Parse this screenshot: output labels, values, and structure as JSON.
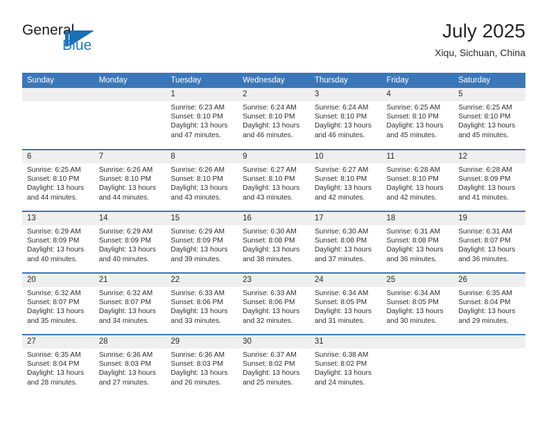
{
  "logo": {
    "word1": "General",
    "word2": "Blue",
    "mark": "flag-triangle-icon"
  },
  "header": {
    "title": "July 2025",
    "subtitle": "Xiqu, Sichuan, China"
  },
  "colors": {
    "header_blue": "#3b77b8",
    "logo_blue": "#1b6fb5",
    "daynum_band": "#efefef",
    "text": "#2d2d2d"
  },
  "weekday_headers": [
    "Sunday",
    "Monday",
    "Tuesday",
    "Wednesday",
    "Thursday",
    "Friday",
    "Saturday"
  ],
  "labels": {
    "sunrise_prefix": "Sunrise:",
    "sunset_prefix": "Sunset:",
    "daylight_prefix": "Daylight:"
  },
  "weeks": [
    [
      {
        "day": "",
        "sunrise": "",
        "sunset": "",
        "daylight_line1": "",
        "daylight_line2": ""
      },
      {
        "day": "",
        "sunrise": "",
        "sunset": "",
        "daylight_line1": "",
        "daylight_line2": ""
      },
      {
        "day": "1",
        "sunrise": "Sunrise: 6:23 AM",
        "sunset": "Sunset: 8:10 PM",
        "daylight_line1": "Daylight: 13 hours",
        "daylight_line2": "and 47 minutes."
      },
      {
        "day": "2",
        "sunrise": "Sunrise: 6:24 AM",
        "sunset": "Sunset: 8:10 PM",
        "daylight_line1": "Daylight: 13 hours",
        "daylight_line2": "and 46 minutes."
      },
      {
        "day": "3",
        "sunrise": "Sunrise: 6:24 AM",
        "sunset": "Sunset: 8:10 PM",
        "daylight_line1": "Daylight: 13 hours",
        "daylight_line2": "and 46 minutes."
      },
      {
        "day": "4",
        "sunrise": "Sunrise: 6:25 AM",
        "sunset": "Sunset: 8:10 PM",
        "daylight_line1": "Daylight: 13 hours",
        "daylight_line2": "and 45 minutes."
      },
      {
        "day": "5",
        "sunrise": "Sunrise: 6:25 AM",
        "sunset": "Sunset: 8:10 PM",
        "daylight_line1": "Daylight: 13 hours",
        "daylight_line2": "and 45 minutes."
      }
    ],
    [
      {
        "day": "6",
        "sunrise": "Sunrise: 6:25 AM",
        "sunset": "Sunset: 8:10 PM",
        "daylight_line1": "Daylight: 13 hours",
        "daylight_line2": "and 44 minutes."
      },
      {
        "day": "7",
        "sunrise": "Sunrise: 6:26 AM",
        "sunset": "Sunset: 8:10 PM",
        "daylight_line1": "Daylight: 13 hours",
        "daylight_line2": "and 44 minutes."
      },
      {
        "day": "8",
        "sunrise": "Sunrise: 6:26 AM",
        "sunset": "Sunset: 8:10 PM",
        "daylight_line1": "Daylight: 13 hours",
        "daylight_line2": "and 43 minutes."
      },
      {
        "day": "9",
        "sunrise": "Sunrise: 6:27 AM",
        "sunset": "Sunset: 8:10 PM",
        "daylight_line1": "Daylight: 13 hours",
        "daylight_line2": "and 43 minutes."
      },
      {
        "day": "10",
        "sunrise": "Sunrise: 6:27 AM",
        "sunset": "Sunset: 8:10 PM",
        "daylight_line1": "Daylight: 13 hours",
        "daylight_line2": "and 42 minutes."
      },
      {
        "day": "11",
        "sunrise": "Sunrise: 6:28 AM",
        "sunset": "Sunset: 8:10 PM",
        "daylight_line1": "Daylight: 13 hours",
        "daylight_line2": "and 42 minutes."
      },
      {
        "day": "12",
        "sunrise": "Sunrise: 6:28 AM",
        "sunset": "Sunset: 8:09 PM",
        "daylight_line1": "Daylight: 13 hours",
        "daylight_line2": "and 41 minutes."
      }
    ],
    [
      {
        "day": "13",
        "sunrise": "Sunrise: 6:29 AM",
        "sunset": "Sunset: 8:09 PM",
        "daylight_line1": "Daylight: 13 hours",
        "daylight_line2": "and 40 minutes."
      },
      {
        "day": "14",
        "sunrise": "Sunrise: 6:29 AM",
        "sunset": "Sunset: 8:09 PM",
        "daylight_line1": "Daylight: 13 hours",
        "daylight_line2": "and 40 minutes."
      },
      {
        "day": "15",
        "sunrise": "Sunrise: 6:29 AM",
        "sunset": "Sunset: 8:09 PM",
        "daylight_line1": "Daylight: 13 hours",
        "daylight_line2": "and 39 minutes."
      },
      {
        "day": "16",
        "sunrise": "Sunrise: 6:30 AM",
        "sunset": "Sunset: 8:08 PM",
        "daylight_line1": "Daylight: 13 hours",
        "daylight_line2": "and 38 minutes."
      },
      {
        "day": "17",
        "sunrise": "Sunrise: 6:30 AM",
        "sunset": "Sunset: 8:08 PM",
        "daylight_line1": "Daylight: 13 hours",
        "daylight_line2": "and 37 minutes."
      },
      {
        "day": "18",
        "sunrise": "Sunrise: 6:31 AM",
        "sunset": "Sunset: 8:08 PM",
        "daylight_line1": "Daylight: 13 hours",
        "daylight_line2": "and 36 minutes."
      },
      {
        "day": "19",
        "sunrise": "Sunrise: 6:31 AM",
        "sunset": "Sunset: 8:07 PM",
        "daylight_line1": "Daylight: 13 hours",
        "daylight_line2": "and 36 minutes."
      }
    ],
    [
      {
        "day": "20",
        "sunrise": "Sunrise: 6:32 AM",
        "sunset": "Sunset: 8:07 PM",
        "daylight_line1": "Daylight: 13 hours",
        "daylight_line2": "and 35 minutes."
      },
      {
        "day": "21",
        "sunrise": "Sunrise: 6:32 AM",
        "sunset": "Sunset: 8:07 PM",
        "daylight_line1": "Daylight: 13 hours",
        "daylight_line2": "and 34 minutes."
      },
      {
        "day": "22",
        "sunrise": "Sunrise: 6:33 AM",
        "sunset": "Sunset: 8:06 PM",
        "daylight_line1": "Daylight: 13 hours",
        "daylight_line2": "and 33 minutes."
      },
      {
        "day": "23",
        "sunrise": "Sunrise: 6:33 AM",
        "sunset": "Sunset: 8:06 PM",
        "daylight_line1": "Daylight: 13 hours",
        "daylight_line2": "and 32 minutes."
      },
      {
        "day": "24",
        "sunrise": "Sunrise: 6:34 AM",
        "sunset": "Sunset: 8:05 PM",
        "daylight_line1": "Daylight: 13 hours",
        "daylight_line2": "and 31 minutes."
      },
      {
        "day": "25",
        "sunrise": "Sunrise: 6:34 AM",
        "sunset": "Sunset: 8:05 PM",
        "daylight_line1": "Daylight: 13 hours",
        "daylight_line2": "and 30 minutes."
      },
      {
        "day": "26",
        "sunrise": "Sunrise: 6:35 AM",
        "sunset": "Sunset: 8:04 PM",
        "daylight_line1": "Daylight: 13 hours",
        "daylight_line2": "and 29 minutes."
      }
    ],
    [
      {
        "day": "27",
        "sunrise": "Sunrise: 6:35 AM",
        "sunset": "Sunset: 8:04 PM",
        "daylight_line1": "Daylight: 13 hours",
        "daylight_line2": "and 28 minutes."
      },
      {
        "day": "28",
        "sunrise": "Sunrise: 6:36 AM",
        "sunset": "Sunset: 8:03 PM",
        "daylight_line1": "Daylight: 13 hours",
        "daylight_line2": "and 27 minutes."
      },
      {
        "day": "29",
        "sunrise": "Sunrise: 6:36 AM",
        "sunset": "Sunset: 8:03 PM",
        "daylight_line1": "Daylight: 13 hours",
        "daylight_line2": "and 26 minutes."
      },
      {
        "day": "30",
        "sunrise": "Sunrise: 6:37 AM",
        "sunset": "Sunset: 8:02 PM",
        "daylight_line1": "Daylight: 13 hours",
        "daylight_line2": "and 25 minutes."
      },
      {
        "day": "31",
        "sunrise": "Sunrise: 6:38 AM",
        "sunset": "Sunset: 8:02 PM",
        "daylight_line1": "Daylight: 13 hours",
        "daylight_line2": "and 24 minutes."
      },
      {
        "day": "",
        "sunrise": "",
        "sunset": "",
        "daylight_line1": "",
        "daylight_line2": ""
      },
      {
        "day": "",
        "sunrise": "",
        "sunset": "",
        "daylight_line1": "",
        "daylight_line2": ""
      }
    ]
  ]
}
